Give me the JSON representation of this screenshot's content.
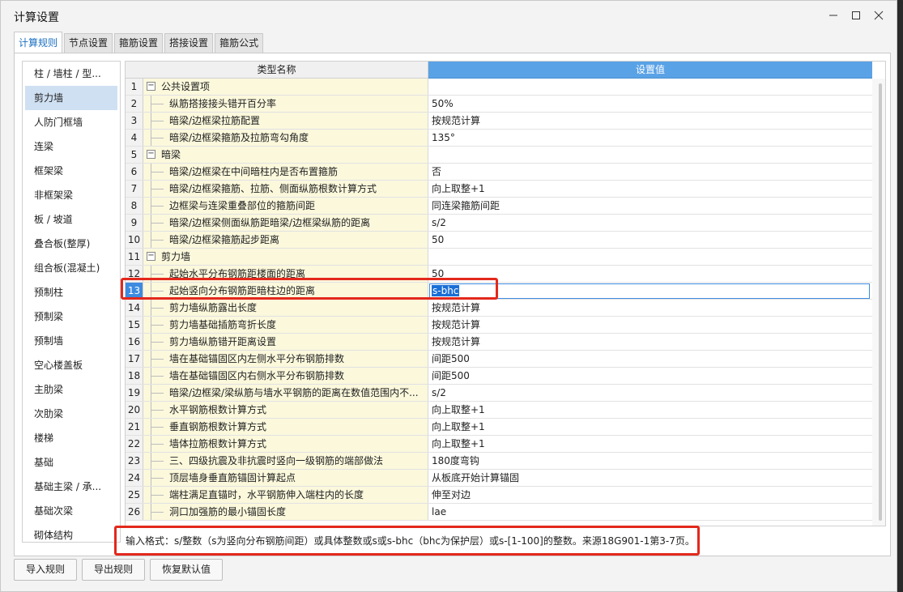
{
  "window": {
    "title": "计算设置"
  },
  "tabs": [
    {
      "label": "计算规则",
      "active": true
    },
    {
      "label": "节点设置"
    },
    {
      "label": "箍筋设置"
    },
    {
      "label": "搭接设置"
    },
    {
      "label": "箍筋公式"
    }
  ],
  "sidebar": {
    "selected_index": 1,
    "items": [
      "柱 / 墙柱 / 型...",
      "剪力墙",
      "人防门框墙",
      "连梁",
      "框架梁",
      "非框架梁",
      "板 / 坡道",
      "叠合板(整厚)",
      "组合板(混凝土)",
      "预制柱",
      "预制梁",
      "预制墙",
      "空心楼盖板",
      "主肋梁",
      "次肋梁",
      "楼梯",
      "基础",
      "基础主梁 / 承...",
      "基础次梁",
      "砌体结构"
    ]
  },
  "grid": {
    "header_type": "类型名称",
    "header_value": "设置值",
    "active_row": 13,
    "rows": [
      {
        "n": "1",
        "name": "公共设置项",
        "value": "",
        "group": true
      },
      {
        "n": "2",
        "name": "纵筋搭接接头错开百分率",
        "value": "50%"
      },
      {
        "n": "3",
        "name": "暗梁/边框梁拉筋配置",
        "value": "按规范计算"
      },
      {
        "n": "4",
        "name": "暗梁/边框梁箍筋及拉筋弯勾角度",
        "value": "135°"
      },
      {
        "n": "5",
        "name": "暗梁",
        "value": "",
        "group": true
      },
      {
        "n": "6",
        "name": "暗梁/边框梁在中间暗柱内是否布置箍筋",
        "value": "否"
      },
      {
        "n": "7",
        "name": "暗梁/边框梁箍筋、拉筋、侧面纵筋根数计算方式",
        "value": "向上取整+1"
      },
      {
        "n": "8",
        "name": "边框梁与连梁重叠部位的箍筋间距",
        "value": "同连梁箍筋间距"
      },
      {
        "n": "9",
        "name": "暗梁/边框梁侧面纵筋距暗梁/边框梁纵筋的距离",
        "value": "s/2"
      },
      {
        "n": "10",
        "name": "暗梁/边框梁箍筋起步距离",
        "value": "50"
      },
      {
        "n": "11",
        "name": "剪力墙",
        "value": "",
        "group": true
      },
      {
        "n": "12",
        "name": "起始水平分布钢筋距楼面的距离",
        "value": "50"
      },
      {
        "n": "13",
        "name": "起始竖向分布钢筋距暗柱边的距离",
        "value": "s-bhc"
      },
      {
        "n": "14",
        "name": "剪力墙纵筋露出长度",
        "value": "按规范计算"
      },
      {
        "n": "15",
        "name": "剪力墙基础插筋弯折长度",
        "value": "按规范计算"
      },
      {
        "n": "16",
        "name": "剪力墙纵筋错开距离设置",
        "value": "按规范计算"
      },
      {
        "n": "17",
        "name": "墙在基础锚固区内左侧水平分布钢筋排数",
        "value": "间距500"
      },
      {
        "n": "18",
        "name": "墙在基础锚固区内右侧水平分布钢筋排数",
        "value": "间距500"
      },
      {
        "n": "19",
        "name": "暗梁/边框梁/梁纵筋与墙水平钢筋的距离在数值范围内不...",
        "value": "s/2"
      },
      {
        "n": "20",
        "name": "水平钢筋根数计算方式",
        "value": "向上取整+1"
      },
      {
        "n": "21",
        "name": "垂直钢筋根数计算方式",
        "value": "向上取整+1"
      },
      {
        "n": "22",
        "name": "墙体拉筋根数计算方式",
        "value": "向上取整+1"
      },
      {
        "n": "23",
        "name": "三、四级抗震及非抗震时竖向一级钢筋的端部做法",
        "value": "180度弯钩"
      },
      {
        "n": "24",
        "name": "顶层墙身垂直筋锚固计算起点",
        "value": "从板底开始计算锚固"
      },
      {
        "n": "25",
        "name": "端柱满足直锚时，水平钢筋伸入端柱内的长度",
        "value": "伸至对边"
      },
      {
        "n": "26",
        "name": "洞口加强筋的最小锚固长度",
        "value": "lae"
      }
    ]
  },
  "hint": "输入格式：s/整数（s为竖向分布钢筋间距）或具体整数或s或s-bhc（bhc为保护层）或s-[1-100]的整数。来源18G901-1第3-7页。",
  "footer": {
    "import": "导入规则",
    "export": "导出规则",
    "reset": "恢复默认值"
  }
}
